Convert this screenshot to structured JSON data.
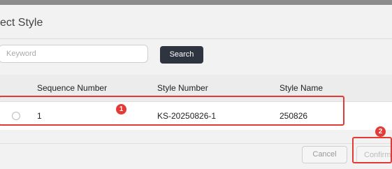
{
  "dialog": {
    "title": "ect Style"
  },
  "search": {
    "placeholder": "Keyword",
    "value": "",
    "button_label": "Search"
  },
  "table": {
    "columns": [
      "Sequence Number",
      "Style Number",
      "Style Name"
    ],
    "rows": [
      {
        "selected": false,
        "sequence_number": "1",
        "style_number": "KS-20250826-1",
        "style_name": "250826"
      }
    ]
  },
  "footer": {
    "cancel_label": "Cancel",
    "confirm_label": "Confirm"
  },
  "annotations": {
    "step1": "1",
    "step2": "2",
    "highlight_color": "#e53935"
  },
  "colors": {
    "search_button_bg": "#2f3540",
    "dialog_bg": "#f2f2f2"
  }
}
